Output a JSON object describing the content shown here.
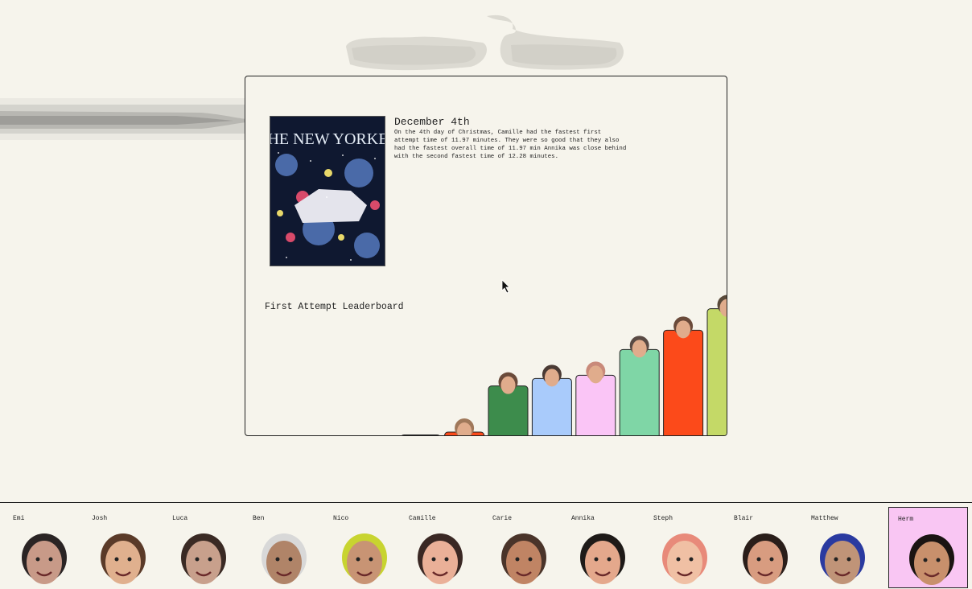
{
  "entry": {
    "title": "December 4th",
    "text": "On the 4th day of Christmas, Camille had the fastest first attempt time of 11.97 minutes. They were so good that they also had the fastest overall time of 11.97 min Annika was close behind with the second fastest time of 12.28 minutes.",
    "cover_masthead": "THE NEW YORKER"
  },
  "chart_data": {
    "type": "bar",
    "title": "First Attempt Leaderboard",
    "categories": [
      "Emi",
      "Josh",
      "Luca",
      "Ben",
      "Nico",
      "Camille",
      "Carie",
      "Annika",
      "Steph",
      "Blair",
      "Matthew",
      "Herm"
    ],
    "values": [
      0,
      0,
      0,
      0.2,
      1.5,
      23,
      26.5,
      28,
      40,
      49,
      59
    ],
    "ylim": [
      0,
      60
    ],
    "colors": [
      "#f6f4ec",
      "#f6f4ec",
      "#f6f4ec",
      "#c8c4b4",
      "#fc4a1a",
      "#3d8c4c",
      "#a9cbfb",
      "#fac5f6",
      "#7fd6a6",
      "#fc4a1a",
      "#c4d967"
    ],
    "face_colors": [
      "#2a2a2a",
      "#6b4a34",
      "#5a4a40",
      "#8a6a4a",
      "#a0785a",
      "#6a4a3a",
      "#4a3a34",
      "#c98a7a",
      "#5a4a44",
      "#6a4a3a",
      "#5a4a3a"
    ],
    "legend": "none",
    "grid": false
  },
  "players": [
    {
      "name": "Emi",
      "color": "#2a2424",
      "skin": "#c89a88",
      "selected": false
    },
    {
      "name": "Josh",
      "color": "#5a3a28",
      "skin": "#e0b08e",
      "selected": false
    },
    {
      "name": "Luca",
      "color": "#3a2a24",
      "skin": "#c8a08c",
      "selected": false
    },
    {
      "name": "Ben",
      "color": "#d8d8d8",
      "skin": "#b08468",
      "selected": false
    },
    {
      "name": "Nico",
      "color": "#c8d430",
      "skin": "#c89474",
      "selected": false
    },
    {
      "name": "Camille",
      "color": "#3a2824",
      "skin": "#eab098",
      "selected": false
    },
    {
      "name": "Carie",
      "color": "#4a342a",
      "skin": "#c08464",
      "selected": false
    },
    {
      "name": "Annika",
      "color": "#1e1a18",
      "skin": "#e4a88c",
      "selected": false
    },
    {
      "name": "Steph",
      "color": "#e88a7a",
      "skin": "#f0c0a4",
      "selected": false
    },
    {
      "name": "Blair",
      "color": "#2a1e1a",
      "skin": "#d89c80",
      "selected": false
    },
    {
      "name": "Matthew",
      "color": "#2a3aa0",
      "skin": "#c09478",
      "selected": false
    },
    {
      "name": "Herm",
      "color": "#1a1412",
      "skin": "#c8906c",
      "selected": true
    }
  ],
  "icons": {
    "cursor": "arrow-cursor-icon"
  }
}
